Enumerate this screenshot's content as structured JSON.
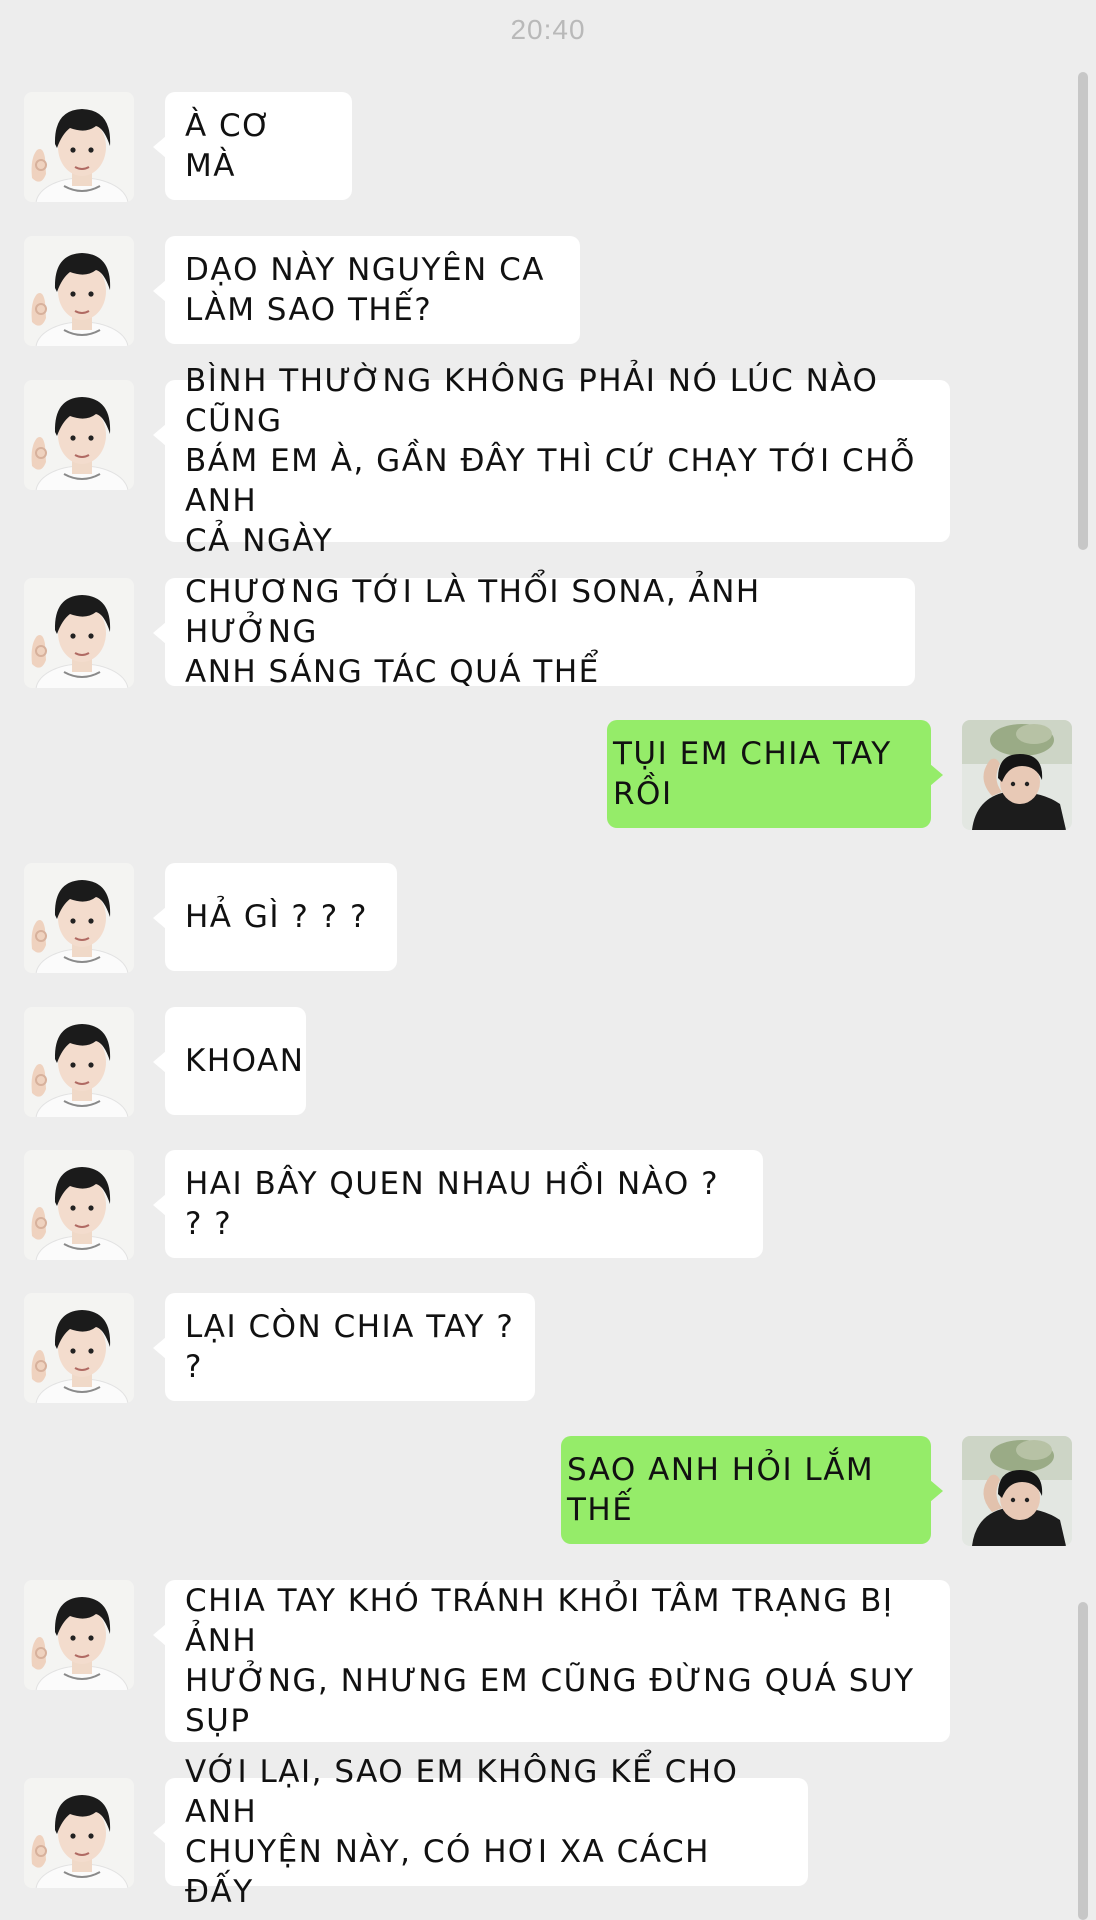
{
  "status_time": "20:40",
  "messages": [
    {
      "side": "in",
      "text": "À CƠ MÀ"
    },
    {
      "side": "in",
      "text": "DẠO NÀY NGUYÊN CA\nLÀM SAO THẾ?"
    },
    {
      "side": "in",
      "text": "BÌNH THƯỜNG KHÔNG PHẢI NÓ LÚC NÀO CŨNG\nBÁM EM À, GẦN ĐÂY THÌ CỨ CHẠY TỚI CHỖ ANH\nCẢ NGÀY"
    },
    {
      "side": "in",
      "text": "CHƯƠNG TỚI LÀ THỔI SONA, ẢNH HƯỞNG\nANH SÁNG TÁC QUÁ THỂ"
    },
    {
      "side": "out",
      "text": "TỤI EM CHIA TAY RỒI"
    },
    {
      "side": "in",
      "text": "HẢ GÌ ? ? ?"
    },
    {
      "side": "in",
      "text": "KHOAN"
    },
    {
      "side": "in",
      "text": "HAI BÂY QUEN NHAU HỒI NÀO ? ? ?"
    },
    {
      "side": "in",
      "text": "LẠI CÒN CHIA TAY ? ?"
    },
    {
      "side": "out",
      "text": "SAO ANH HỎI LẮM THẾ"
    },
    {
      "side": "in",
      "text": "CHIA TAY KHÓ TRÁNH KHỎI TÂM TRẠNG BỊ ẢNH\nHƯỞNG, NHƯNG EM CŨNG ĐỪNG QUÁ SUY SỤP"
    },
    {
      "side": "in",
      "text": "VỚI LẠI, SAO EM KHÔNG KỂ CHO ANH\nCHUYỆN NÀY, CÓ HƠI XA CÁCH ĐẤY"
    }
  ],
  "colors": {
    "background": "#ededed",
    "incoming_bubble": "#ffffff",
    "outgoing_bubble": "#95ec69",
    "timestamp": "#b9b9b9"
  },
  "icons": {
    "incoming_avatar": "contact-avatar-icon",
    "outgoing_avatar": "user-avatar-icon"
  }
}
